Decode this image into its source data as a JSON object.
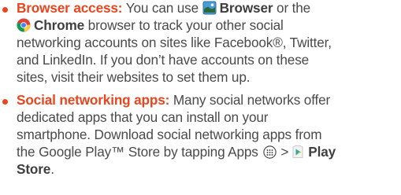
{
  "bullets": [
    {
      "lead": "Browser access:",
      "t1": " You can use ",
      "browser_app": "Browser",
      "t2": " or the",
      "chrome_app": "Chrome",
      "t3": " browser to track your other social",
      "line3": "networking accounts on sites like Facebook®, Twitter,",
      "line4": "and LinkedIn. If you don’t have accounts on these",
      "line5": "sites, visit their websites to set them up."
    },
    {
      "lead": "Social networking apps:",
      "t1": " Many social networks offer",
      "line2": "dedicated apps that you can install on your",
      "line3": "smartphone. Download social networking apps from",
      "line4_text": "the Google Play™ Store by tapping Apps ",
      "gt": ">",
      "play_store_label_1": "Play",
      "play_store_label_2": "Store",
      "end": "."
    }
  ],
  "icons": {
    "bullet_color": "#e8461f",
    "browser_icon": "browser-globe-icon",
    "chrome_icon": "chrome-icon",
    "apps_icon": "apps-grid-icon",
    "play_store_icon": "play-store-icon"
  }
}
